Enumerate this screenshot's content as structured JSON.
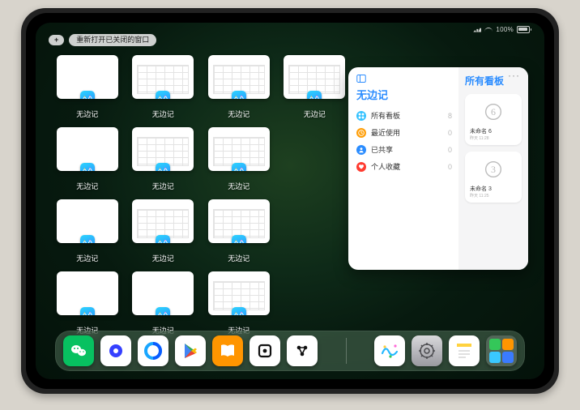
{
  "status": {
    "pct": "100%"
  },
  "topbar": {
    "add_label": "+",
    "reopen_label": "重新打开已关闭的窗口"
  },
  "thumb_label": "无边记",
  "thumbs": [
    {
      "kind": "blank"
    },
    {
      "kind": "grid"
    },
    {
      "kind": "grid"
    },
    {
      "kind": "grid"
    },
    {
      "kind": "blank"
    },
    {
      "kind": "grid"
    },
    {
      "kind": "grid"
    },
    null,
    {
      "kind": "blank"
    },
    {
      "kind": "grid"
    },
    {
      "kind": "grid"
    },
    null,
    {
      "kind": "blank"
    },
    {
      "kind": "blank"
    },
    {
      "kind": "grid"
    },
    null
  ],
  "panel": {
    "left_title": "无边记",
    "right_title": "所有看板",
    "categories": [
      {
        "icon": "grid",
        "color": "#35c2ff",
        "label": "所有看板",
        "count": "8"
      },
      {
        "icon": "clock",
        "color": "#ff9f0a",
        "label": "最近使用",
        "count": "0"
      },
      {
        "icon": "person",
        "color": "#2a8cff",
        "label": "已共享",
        "count": "0"
      },
      {
        "icon": "heart",
        "color": "#ff3b30",
        "label": "个人收藏",
        "count": "0"
      }
    ],
    "boards": [
      {
        "glyph": "6",
        "name": "未命名 6",
        "time": "昨天 11:28"
      },
      {
        "glyph": "3",
        "name": "未命名 3",
        "time": "昨天 11:25"
      }
    ]
  },
  "dock": {
    "left": [
      "wechat",
      "quark",
      "qq-browser",
      "playstore",
      "books",
      "obsidian-like",
      "roam"
    ],
    "right": [
      "freeform",
      "settings",
      "notes",
      "folder"
    ]
  }
}
